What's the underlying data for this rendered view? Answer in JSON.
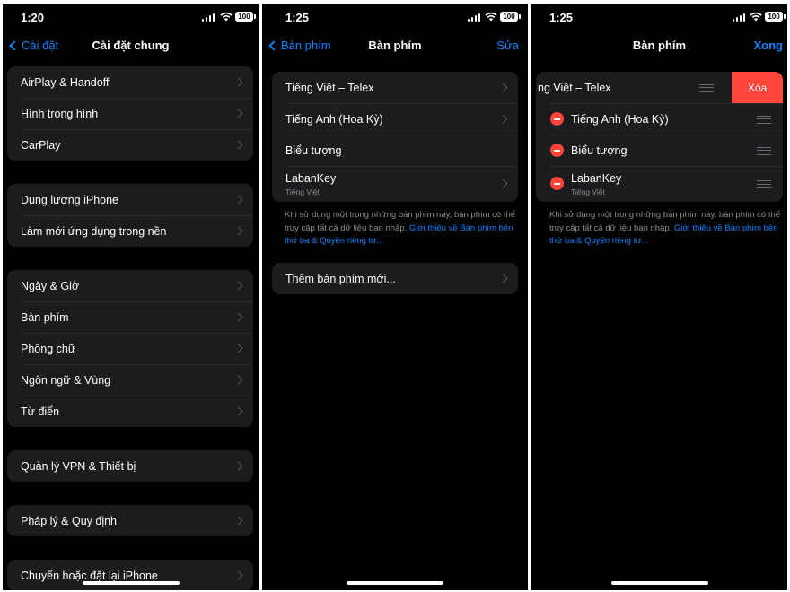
{
  "screen1": {
    "time": "1:20",
    "battery": "100",
    "back_label": "Cài đặt",
    "title": "Cài đặt chung",
    "groups": [
      [
        "AirPlay & Handoff",
        "Hình trong hình",
        "CarPlay"
      ],
      [
        "Dung lượng iPhone",
        "Làm mới ứng dụng trong nền"
      ],
      [
        "Ngày & Giờ",
        "Bàn phím",
        "Phông chữ",
        "Ngôn ngữ & Vùng",
        "Từ điển"
      ],
      [
        "Quản lý VPN & Thiết bị"
      ],
      [
        "Pháp lý & Quy định"
      ],
      [
        "Chuyển hoặc đặt lại iPhone"
      ]
    ]
  },
  "screen2": {
    "time": "1:25",
    "battery": "100",
    "back_label": "Bàn phím",
    "title": "Bàn phím",
    "edit_label": "Sửa",
    "keyboards": [
      {
        "name": "Tiếng Việt – Telex",
        "sub": ""
      },
      {
        "name": "Tiếng Anh (Hoa Kỳ)",
        "sub": ""
      },
      {
        "name": "Biểu tượng",
        "sub": ""
      },
      {
        "name": "LabanKey",
        "sub": "Tiếng Việt"
      }
    ],
    "note_lines": [
      "Khi sử dụng một trong những bàn phím này, bàn phím có thể",
      "truy cập tất cả dữ liệu bạn nhập."
    ],
    "note_link_1": "Giới thiệu về Bàn phím bên",
    "note_link_2": "thứ ba & Quyền riêng tư...",
    "add_keyboard": "Thêm bàn phím mới..."
  },
  "screen3": {
    "time": "1:25",
    "battery": "100",
    "title": "Bàn phím",
    "done_label": "Xong",
    "delete_label": "Xóa",
    "keyboards": [
      {
        "name": "ng Việt – Telex",
        "sub": ""
      },
      {
        "name": "Tiếng Anh (Hoa Kỳ)",
        "sub": ""
      },
      {
        "name": "Biểu tượng",
        "sub": ""
      },
      {
        "name": "LabanKey",
        "sub": "Tiếng Việt"
      }
    ],
    "note_lines": [
      "Khi sử dụng một trong những bàn phím này, bàn phím có thể",
      "truy cập tất cả dữ liệu bạn nhập."
    ],
    "note_link_1": "Giới thiệu về Bàn phím bên",
    "note_link_2": "thứ ba & Quyền riêng tư..."
  },
  "colors": {
    "accent": "#0a84ff",
    "destructive": "#ff453a",
    "cell": "#1c1c1e",
    "background": "#000000"
  }
}
